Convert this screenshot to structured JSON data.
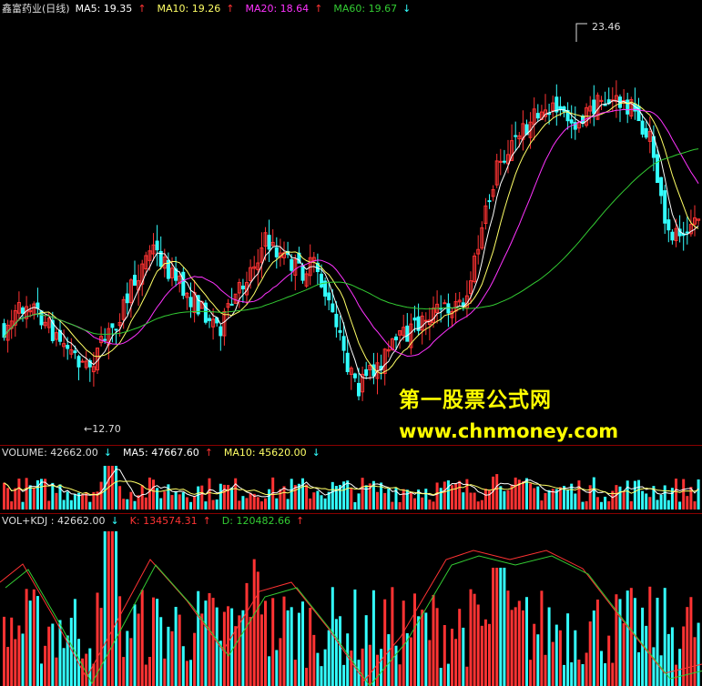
{
  "main_legend": {
    "title": "鑫富药业(日线)",
    "ma5": "MA5: 19.35",
    "ma10": "MA10: 19.26",
    "ma20": "MA20: 18.64",
    "ma60": "MA60: 19.67",
    "ma5_dir": "↑",
    "ma10_dir": "↑",
    "ma20_dir": "↑",
    "ma60_dir": "↓"
  },
  "price_marks": {
    "high": "23.46",
    "low": "←12.70"
  },
  "volume_legend": {
    "title": "VOLUME: 42662.00",
    "title_dir": "↓",
    "ma5": "MA5: 47667.60",
    "ma5_dir": "↑",
    "ma10": "MA10: 45620.00",
    "ma10_dir": "↓"
  },
  "kdj_legend": {
    "title": "VOL+KDJ : 42662.00",
    "title_dir": "↓",
    "k": "K: 134574.31",
    "k_dir": "↑",
    "d": "D: 120482.66",
    "d_dir": "↑"
  },
  "watermark": {
    "cn": "第一股票公式网",
    "url": "www.chnmoney.com"
  },
  "colors": {
    "up": "#ff3333",
    "down": "#33ffff",
    "ma5": "#ffffff",
    "ma10": "#ffff66",
    "ma20": "#ff33ff",
    "ma60": "#33cc33",
    "grid": "#8b0000",
    "watermark": "#ffff00"
  }
}
